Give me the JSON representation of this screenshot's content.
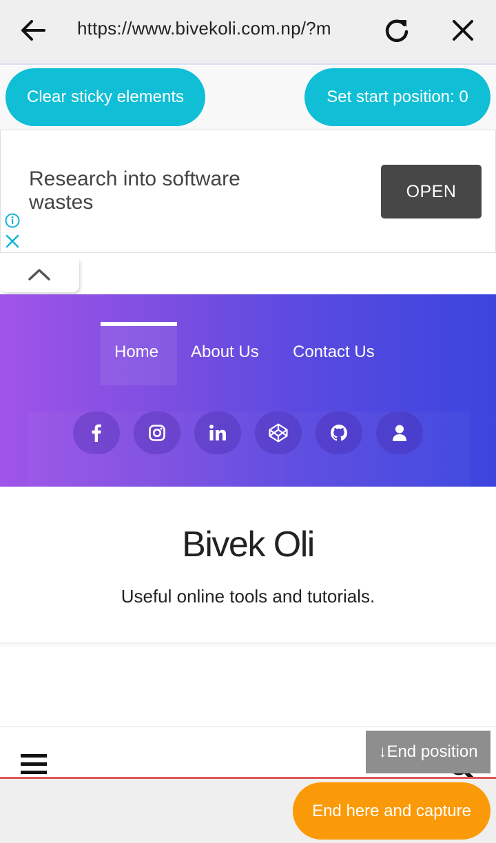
{
  "browser": {
    "url": "https://www.bivekoli.com.np/?m",
    "back_icon": "arrow-left-icon",
    "reload_icon": "reload-icon",
    "close_icon": "close-icon"
  },
  "capture_tool": {
    "clear_label": "Clear sticky elements",
    "start_label": "Set start position: 0",
    "end_position_label": "↓End position",
    "capture_label": "End here and capture",
    "accent_cyan": "#10bfd6",
    "accent_orange": "#fb9a08"
  },
  "ad": {
    "text": "Research into software wastes",
    "button_label": "OPEN",
    "info_icon": "info-icon",
    "close_icon": "close-icon"
  },
  "collapse_icon": "chevron-up-icon",
  "site": {
    "nav": [
      {
        "label": "Home",
        "active": true
      },
      {
        "label": "About Us",
        "active": false
      },
      {
        "label": "Contact Us",
        "active": false
      }
    ],
    "social_icons": [
      "facebook-icon",
      "instagram-icon",
      "linkedin-icon",
      "codepen-icon",
      "github-icon",
      "user-icon"
    ],
    "title": "Bivek Oli",
    "tagline": "Useful online tools and tutorials.",
    "menu_icon": "hamburger-icon",
    "search_icon": "search-icon"
  }
}
